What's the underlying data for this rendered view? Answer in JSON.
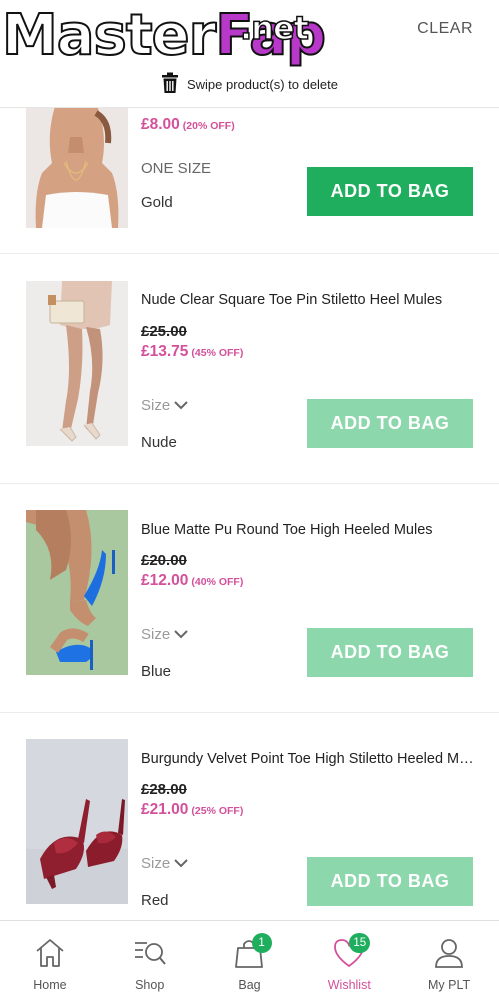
{
  "header": {
    "watermark_main": "Master",
    "watermark_accent": "Fap",
    "watermark_tld": ".net",
    "clear_label": "CLEAR",
    "swipe_hint": "Swipe product(s) to delete"
  },
  "items": [
    {
      "new_price": "£8.00",
      "discount": "(20% OFF)",
      "size_label": "ONE SIZE",
      "size_value": "Gold",
      "button_label": "ADD TO BAG",
      "button_state": "active"
    },
    {
      "name": "Nude Clear Square Toe Pin Stiletto Heel Mules",
      "old_price": "£25.00",
      "new_price": "£13.75",
      "discount": "(45% OFF)",
      "size_label": "Size",
      "size_value": "Nude",
      "button_label": "ADD TO BAG",
      "button_state": "muted"
    },
    {
      "name": "Blue Matte Pu Round Toe High Heeled Mules",
      "old_price": "£20.00",
      "new_price": "£12.00",
      "discount": "(40% OFF)",
      "size_label": "Size",
      "size_value": "Blue",
      "button_label": "ADD TO BAG",
      "button_state": "muted"
    },
    {
      "name": "Burgundy Velvet Point Toe High Stiletto Heeled Mules",
      "old_price": "£28.00",
      "new_price": "£21.00",
      "discount": "(25% OFF)",
      "size_label": "Size",
      "size_value": "Red",
      "button_label": "ADD TO BAG",
      "button_state": "muted"
    }
  ],
  "nav": {
    "home": "Home",
    "shop": "Shop",
    "bag": "Bag",
    "bag_count": "1",
    "wishlist": "Wishlist",
    "wishlist_count": "15",
    "account": "My PLT"
  },
  "colors": {
    "accent_green": "#1fae5e",
    "muted_green": "#8cd7ab",
    "price_pink": "#d3509a"
  }
}
